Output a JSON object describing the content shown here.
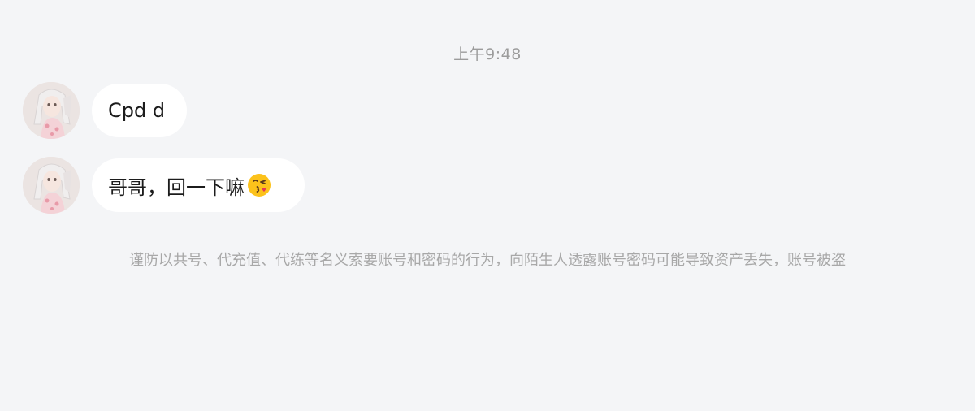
{
  "timestamp": "上午9:48",
  "messages": [
    {
      "text": "Cpd d",
      "emoji": null
    },
    {
      "text": "哥哥，回一下嘛",
      "emoji": "face-blowing-kiss-icon"
    }
  ],
  "security_notice": "谨防以共号、代充值、代练等名义索要账号和密码的行为，向陌生人透露账号密码可能导致资产丢失，账号被盗",
  "colors": {
    "background": "#f4f5f7",
    "bubble": "#ffffff",
    "text": "#1c1c1c",
    "muted_text": "#9c9c9c"
  }
}
